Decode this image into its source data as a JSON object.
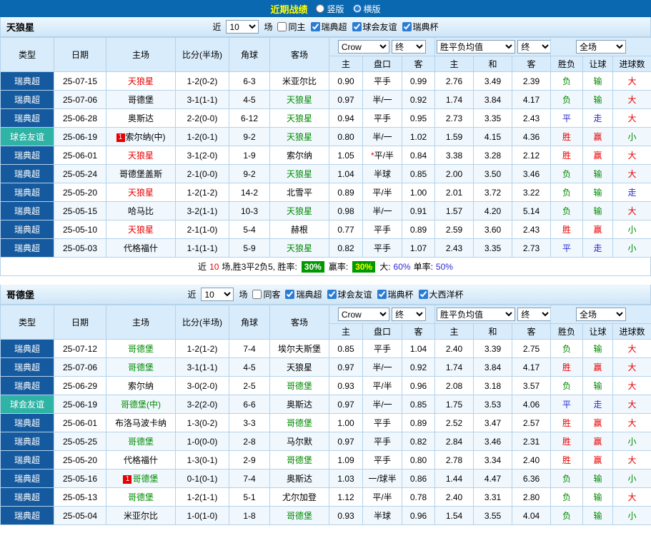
{
  "colors": {
    "red": "#e60000",
    "green": "#008a00",
    "blue": "#2929d6",
    "black": "#000000",
    "league_super_bg": "#15599e",
    "league_friendly_bg": "#2fb3a5",
    "topbar_bg": "#0a68b0",
    "header_bg": "#d9ecfb",
    "rate_box_bg": "#009900"
  },
  "topbar": {
    "title": "近期战绩",
    "options": [
      {
        "label": "竖版",
        "selected": false
      },
      {
        "label": "横版",
        "selected": true
      }
    ]
  },
  "table_header": {
    "cols": [
      "类型",
      "日期",
      "主场",
      "比分(半场)",
      "角球",
      "客场"
    ],
    "sub": [
      "主",
      "盘口",
      "客",
      "主",
      "和",
      "客",
      "胜负",
      "让球",
      "进球数"
    ],
    "dropdowns": {
      "bookie": "Crow",
      "final1": "终",
      "avg": "胜平负均值",
      "final2": "终",
      "scope": "全场"
    }
  },
  "sections": [
    {
      "team": "天狼星",
      "filter": {
        "near": "近",
        "count": "10",
        "unit": "场",
        "checkboxes": [
          {
            "label": "同主",
            "checked": false
          },
          {
            "label": "瑞典超",
            "checked": true
          },
          {
            "label": "球会友谊",
            "checked": true
          },
          {
            "label": "瑞典杯",
            "checked": true
          }
        ]
      },
      "rows": [
        {
          "league": "瑞典超",
          "league_type": "super",
          "date": "25-07-15",
          "home": {
            "text": "天狼星",
            "color": "red"
          },
          "score": "1-2(0-2)",
          "corner": "6-3",
          "away": {
            "text": "米亚尔比",
            "color": "black"
          },
          "odds": {
            "home": "0.90",
            "handicap": "平手",
            "away": "0.99"
          },
          "avg": {
            "home": "2.76",
            "draw": "3.49",
            "away": "2.39"
          },
          "result": {
            "wdl": "负",
            "wdl_color": "green",
            "handicap": "输",
            "handicap_color": "green",
            "goals": "大",
            "goals_color": "red"
          }
        },
        {
          "league": "瑞典超",
          "league_type": "super",
          "date": "25-07-06",
          "home": {
            "text": "哥德堡",
            "color": "black"
          },
          "score": "3-1(1-1)",
          "corner": "4-5",
          "away": {
            "text": "天狼星",
            "color": "green"
          },
          "odds": {
            "home": "0.97",
            "handicap": "半/一",
            "away": "0.92"
          },
          "avg": {
            "home": "1.74",
            "draw": "3.84",
            "away": "4.17"
          },
          "result": {
            "wdl": "负",
            "wdl_color": "green",
            "handicap": "输",
            "handicap_color": "green",
            "goals": "大",
            "goals_color": "red"
          }
        },
        {
          "league": "瑞典超",
          "league_type": "super",
          "date": "25-06-28",
          "home": {
            "text": "奥斯达",
            "color": "black"
          },
          "score": "2-2(0-0)",
          "corner": "6-12",
          "away": {
            "text": "天狼星",
            "color": "green"
          },
          "odds": {
            "home": "0.94",
            "handicap": "平手",
            "away": "0.95"
          },
          "avg": {
            "home": "2.73",
            "draw": "3.35",
            "away": "2.43"
          },
          "result": {
            "wdl": "平",
            "wdl_color": "blue",
            "handicap": "走",
            "handicap_color": "blue",
            "goals": "大",
            "goals_color": "red"
          }
        },
        {
          "league": "球会友谊",
          "league_type": "friendly",
          "date": "25-06-19",
          "home": {
            "text": "索尔纳(中)",
            "color": "black",
            "badge": "1"
          },
          "score": "1-2(0-1)",
          "corner": "9-2",
          "away": {
            "text": "天狼星",
            "color": "green"
          },
          "odds": {
            "home": "0.80",
            "handicap": "半/一",
            "away": "1.02"
          },
          "avg": {
            "home": "1.59",
            "draw": "4.15",
            "away": "4.36"
          },
          "result": {
            "wdl": "胜",
            "wdl_color": "red",
            "handicap": "赢",
            "handicap_color": "red",
            "goals": "小",
            "goals_color": "green"
          }
        },
        {
          "league": "瑞典超",
          "league_type": "super",
          "date": "25-06-01",
          "home": {
            "text": "天狼星",
            "color": "red"
          },
          "score": "3-1(2-0)",
          "corner": "1-9",
          "away": {
            "text": "索尔纳",
            "color": "black"
          },
          "odds": {
            "home": "1.05",
            "handicap_prefix": "*",
            "handicap": "平/半",
            "away": "0.84"
          },
          "avg": {
            "home": "3.38",
            "draw": "3.28",
            "away": "2.12"
          },
          "result": {
            "wdl": "胜",
            "wdl_color": "red",
            "handicap": "赢",
            "handicap_color": "red",
            "goals": "大",
            "goals_color": "red"
          }
        },
        {
          "league": "瑞典超",
          "league_type": "super",
          "date": "25-05-24",
          "home": {
            "text": "哥德堡盖斯",
            "color": "black"
          },
          "score": "2-1(0-0)",
          "corner": "9-2",
          "away": {
            "text": "天狼星",
            "color": "green"
          },
          "odds": {
            "home": "1.04",
            "handicap": "半球",
            "away": "0.85"
          },
          "avg": {
            "home": "2.00",
            "draw": "3.50",
            "away": "3.46"
          },
          "result": {
            "wdl": "负",
            "wdl_color": "green",
            "handicap": "输",
            "handicap_color": "green",
            "goals": "大",
            "goals_color": "red"
          }
        },
        {
          "league": "瑞典超",
          "league_type": "super",
          "date": "25-05-20",
          "home": {
            "text": "天狼星",
            "color": "red"
          },
          "score": "1-2(1-2)",
          "corner": "14-2",
          "away": {
            "text": "北雪平",
            "color": "black"
          },
          "odds": {
            "home": "0.89",
            "handicap": "平/半",
            "away": "1.00"
          },
          "avg": {
            "home": "2.01",
            "draw": "3.72",
            "away": "3.22"
          },
          "result": {
            "wdl": "负",
            "wdl_color": "green",
            "handicap": "输",
            "handicap_color": "green",
            "goals": "走",
            "goals_color": "blue"
          }
        },
        {
          "league": "瑞典超",
          "league_type": "super",
          "date": "25-05-15",
          "home": {
            "text": "哈马比",
            "color": "black"
          },
          "score": "3-2(1-1)",
          "corner": "10-3",
          "away": {
            "text": "天狼星",
            "color": "green"
          },
          "odds": {
            "home": "0.98",
            "handicap": "半/一",
            "away": "0.91"
          },
          "avg": {
            "home": "1.57",
            "draw": "4.20",
            "away": "5.14"
          },
          "result": {
            "wdl": "负",
            "wdl_color": "green",
            "handicap": "输",
            "handicap_color": "green",
            "goals": "大",
            "goals_color": "red"
          }
        },
        {
          "league": "瑞典超",
          "league_type": "super",
          "date": "25-05-10",
          "home": {
            "text": "天狼星",
            "color": "red"
          },
          "score": "2-1(1-0)",
          "corner": "5-4",
          "away": {
            "text": "赫根",
            "color": "black"
          },
          "odds": {
            "home": "0.77",
            "handicap": "平手",
            "away": "0.89"
          },
          "avg": {
            "home": "2.59",
            "draw": "3.60",
            "away": "2.43"
          },
          "result": {
            "wdl": "胜",
            "wdl_color": "red",
            "handicap": "赢",
            "handicap_color": "red",
            "goals": "小",
            "goals_color": "green"
          }
        },
        {
          "league": "瑞典超",
          "league_type": "super",
          "date": "25-05-03",
          "home": {
            "text": "代格福什",
            "color": "black"
          },
          "score": "1-1(1-1)",
          "corner": "5-9",
          "away": {
            "text": "天狼星",
            "color": "green"
          },
          "odds": {
            "home": "0.82",
            "handicap": "平手",
            "away": "1.07"
          },
          "avg": {
            "home": "2.43",
            "draw": "3.35",
            "away": "2.73"
          },
          "result": {
            "wdl": "平",
            "wdl_color": "blue",
            "handicap": "走",
            "handicap_color": "blue",
            "goals": "小",
            "goals_color": "green"
          }
        }
      ],
      "summary": {
        "near": "近",
        "count": "10",
        "record": "场,胜3平2负5, 胜率:",
        "win_rate": "30%",
        "profit_label": "赢率:",
        "profit_rate": "30%",
        "big_label": "大:",
        "big_rate": "60%",
        "single_label": "单率:",
        "single_rate": "50%"
      }
    },
    {
      "team": "哥德堡",
      "filter": {
        "near": "近",
        "count": "10",
        "unit": "场",
        "checkboxes": [
          {
            "label": "同客",
            "checked": false
          },
          {
            "label": "瑞典超",
            "checked": true
          },
          {
            "label": "球会友谊",
            "checked": true
          },
          {
            "label": "瑞典杯",
            "checked": true
          },
          {
            "label": "大西洋杯",
            "checked": true
          }
        ]
      },
      "rows": [
        {
          "league": "瑞典超",
          "league_type": "super",
          "date": "25-07-12",
          "home": {
            "text": "哥德堡",
            "color": "green"
          },
          "score": "1-2(1-2)",
          "corner": "7-4",
          "away": {
            "text": "埃尔夫斯堡",
            "color": "black"
          },
          "odds": {
            "home": "0.85",
            "handicap": "平手",
            "away": "1.04"
          },
          "avg": {
            "home": "2.40",
            "draw": "3.39",
            "away": "2.75"
          },
          "result": {
            "wdl": "负",
            "wdl_color": "green",
            "handicap": "输",
            "handicap_color": "green",
            "goals": "大",
            "goals_color": "red"
          }
        },
        {
          "league": "瑞典超",
          "league_type": "super",
          "date": "25-07-06",
          "home": {
            "text": "哥德堡",
            "color": "green"
          },
          "score": "3-1(1-1)",
          "corner": "4-5",
          "away": {
            "text": "天狼星",
            "color": "black"
          },
          "odds": {
            "home": "0.97",
            "handicap": "半/一",
            "away": "0.92"
          },
          "avg": {
            "home": "1.74",
            "draw": "3.84",
            "away": "4.17"
          },
          "result": {
            "wdl": "胜",
            "wdl_color": "red",
            "handicap": "赢",
            "handicap_color": "red",
            "goals": "大",
            "goals_color": "red"
          }
        },
        {
          "league": "瑞典超",
          "league_type": "super",
          "date": "25-06-29",
          "home": {
            "text": "索尔纳",
            "color": "black"
          },
          "score": "3-0(2-0)",
          "corner": "2-5",
          "away": {
            "text": "哥德堡",
            "color": "green"
          },
          "odds": {
            "home": "0.93",
            "handicap": "平/半",
            "away": "0.96"
          },
          "avg": {
            "home": "2.08",
            "draw": "3.18",
            "away": "3.57"
          },
          "result": {
            "wdl": "负",
            "wdl_color": "green",
            "handicap": "输",
            "handicap_color": "green",
            "goals": "大",
            "goals_color": "red"
          }
        },
        {
          "league": "球会友谊",
          "league_type": "friendly",
          "date": "25-06-19",
          "home": {
            "text": "哥德堡(中)",
            "color": "green"
          },
          "score": "3-2(2-0)",
          "corner": "6-6",
          "away": {
            "text": "奥斯达",
            "color": "black"
          },
          "odds": {
            "home": "0.97",
            "handicap": "半/一",
            "away": "0.85"
          },
          "avg": {
            "home": "1.75",
            "draw": "3.53",
            "away": "4.06"
          },
          "result": {
            "wdl": "平",
            "wdl_color": "blue",
            "handicap": "走",
            "handicap_color": "blue",
            "goals": "大",
            "goals_color": "red"
          }
        },
        {
          "league": "瑞典超",
          "league_type": "super",
          "date": "25-06-01",
          "home": {
            "text": "布洛马波卡纳",
            "color": "black"
          },
          "score": "1-3(0-2)",
          "corner": "3-3",
          "away": {
            "text": "哥德堡",
            "color": "green"
          },
          "odds": {
            "home": "1.00",
            "handicap": "平手",
            "away": "0.89"
          },
          "avg": {
            "home": "2.52",
            "draw": "3.47",
            "away": "2.57"
          },
          "result": {
            "wdl": "胜",
            "wdl_color": "red",
            "handicap": "赢",
            "handicap_color": "red",
            "goals": "大",
            "goals_color": "red"
          }
        },
        {
          "league": "瑞典超",
          "league_type": "super",
          "date": "25-05-25",
          "home": {
            "text": "哥德堡",
            "color": "green"
          },
          "score": "1-0(0-0)",
          "corner": "2-8",
          "away": {
            "text": "马尔默",
            "color": "black"
          },
          "odds": {
            "home": "0.97",
            "handicap": "平手",
            "away": "0.82"
          },
          "avg": {
            "home": "2.84",
            "draw": "3.46",
            "away": "2.31"
          },
          "result": {
            "wdl": "胜",
            "wdl_color": "red",
            "handicap": "赢",
            "handicap_color": "red",
            "goals": "小",
            "goals_color": "green"
          }
        },
        {
          "league": "瑞典超",
          "league_type": "super",
          "date": "25-05-20",
          "home": {
            "text": "代格福什",
            "color": "black"
          },
          "score": "1-3(0-1)",
          "corner": "2-9",
          "away": {
            "text": "哥德堡",
            "color": "green"
          },
          "odds": {
            "home": "1.09",
            "handicap": "平手",
            "away": "0.80"
          },
          "avg": {
            "home": "2.78",
            "draw": "3.34",
            "away": "2.40"
          },
          "result": {
            "wdl": "胜",
            "wdl_color": "red",
            "handicap": "赢",
            "handicap_color": "red",
            "goals": "大",
            "goals_color": "red"
          }
        },
        {
          "league": "瑞典超",
          "league_type": "super",
          "date": "25-05-16",
          "home": {
            "text": "哥德堡",
            "color": "green",
            "badge": "1"
          },
          "score": "0-1(0-1)",
          "corner": "7-4",
          "away": {
            "text": "奥斯达",
            "color": "black"
          },
          "odds": {
            "home": "1.03",
            "handicap": "一/球半",
            "away": "0.86"
          },
          "avg": {
            "home": "1.44",
            "draw": "4.47",
            "away": "6.36"
          },
          "result": {
            "wdl": "负",
            "wdl_color": "green",
            "handicap": "输",
            "handicap_color": "green",
            "goals": "小",
            "goals_color": "green"
          }
        },
        {
          "league": "瑞典超",
          "league_type": "super",
          "date": "25-05-13",
          "home": {
            "text": "哥德堡",
            "color": "green"
          },
          "score": "1-2(1-1)",
          "corner": "5-1",
          "away": {
            "text": "尤尔加登",
            "color": "black"
          },
          "odds": {
            "home": "1.12",
            "handicap": "平/半",
            "away": "0.78"
          },
          "avg": {
            "home": "2.40",
            "draw": "3.31",
            "away": "2.80"
          },
          "result": {
            "wdl": "负",
            "wdl_color": "green",
            "handicap": "输",
            "handicap_color": "green",
            "goals": "大",
            "goals_color": "red"
          }
        },
        {
          "league": "瑞典超",
          "league_type": "super",
          "date": "25-05-04",
          "home": {
            "text": "米亚尔比",
            "color": "black"
          },
          "score": "1-0(1-0)",
          "corner": "1-8",
          "away": {
            "text": "哥德堡",
            "color": "green"
          },
          "odds": {
            "home": "0.93",
            "handicap": "半球",
            "away": "0.96"
          },
          "avg": {
            "home": "1.54",
            "draw": "3.55",
            "away": "4.04"
          },
          "result": {
            "wdl": "负",
            "wdl_color": "green",
            "handicap": "输",
            "handicap_color": "green",
            "goals": "小",
            "goals_color": "green"
          }
        }
      ]
    }
  ]
}
